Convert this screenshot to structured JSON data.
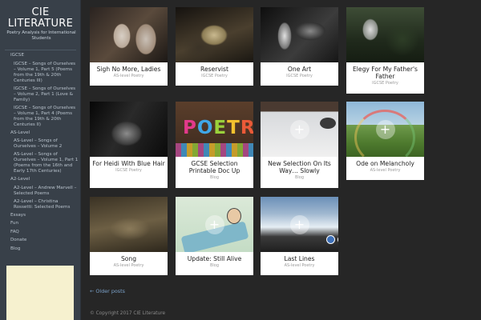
{
  "site": {
    "title_line1": "CIE",
    "title_line2": "LITERATURE",
    "tagline": "Poetry Analysis for International Students"
  },
  "nav": [
    {
      "label": "IGCSE",
      "level": 0
    },
    {
      "label": "IGCSE – Songs of Ourselves – Volume 1, Part 5 (Poems from the 19th & 20th Centuries III)",
      "level": 1
    },
    {
      "label": "IGCSE – Songs of Ourselves – Volume 2, Part 1 (Love & Family)",
      "level": 1
    },
    {
      "label": "IGCSE – Songs of Ourselves – Volume 1, Part 4 (Poems from the 19th & 20th Centuries II)",
      "level": 1
    },
    {
      "label": "AS-Level",
      "level": 0
    },
    {
      "label": "AS-Level – Songs of Ourselves – Volume 2",
      "level": 1
    },
    {
      "label": "AS-Level – Songs of Ourselves – Volume 1, Part 1 (Poems from the 16th and Early 17th Centuries)",
      "level": 1
    },
    {
      "label": "A2-Level",
      "level": 0
    },
    {
      "label": "A2-Level – Andrew Marvell – Selected Poems",
      "level": 1
    },
    {
      "label": "A2-Level – Christina Rossetti: Selected Poems",
      "level": 1
    },
    {
      "label": "Essays",
      "level": 0
    },
    {
      "label": "Fun",
      "level": 0
    },
    {
      "label": "FAQ",
      "level": 0
    },
    {
      "label": "Donate",
      "level": 0
    },
    {
      "label": "Blog",
      "level": 0
    }
  ],
  "posts": [
    {
      "title": "Sigh No More, Ladies",
      "category": "AS-level Poetry",
      "image": "couple-photo"
    },
    {
      "title": "Reservist",
      "category": "IGCSE Poetry",
      "image": "painting-dark"
    },
    {
      "title": "One Art",
      "category": "IGCSE Poetry",
      "image": "hands-bw"
    },
    {
      "title": "Elegy For My Father's Father",
      "category": "IGCSE Poetry",
      "image": "old-man-bench"
    },
    {
      "title": "For Heidi With Blue Hair",
      "category": "IGCSE Poetry",
      "image": "girl-bw"
    },
    {
      "title": "GCSE Selection Printable Doc Up",
      "category": "Blog",
      "image": "poetry-letters"
    },
    {
      "title": "New Selection On Its Way… Slowly",
      "category": "Blog",
      "image": "dog-snow"
    },
    {
      "title": "Ode on Melancholy",
      "category": "AS-level Poetry",
      "image": "rainbow-field"
    },
    {
      "title": "Song",
      "category": "AS-level Poetry",
      "image": "painting-sepia"
    },
    {
      "title": "Update: Still Alive",
      "category": "Blog",
      "image": "hospital-cartoon"
    },
    {
      "title": "Last Lines",
      "category": "AS-level Poetry",
      "image": "mountain-clouds"
    }
  ],
  "pagination": {
    "older": "← Older posts"
  },
  "footer": {
    "copyright": "© Copyright 2017 CIE Literature"
  },
  "colors": {
    "background": "#262626",
    "sidebar": "#384049",
    "card": "#ffffff",
    "link": "#7aa0c8"
  }
}
